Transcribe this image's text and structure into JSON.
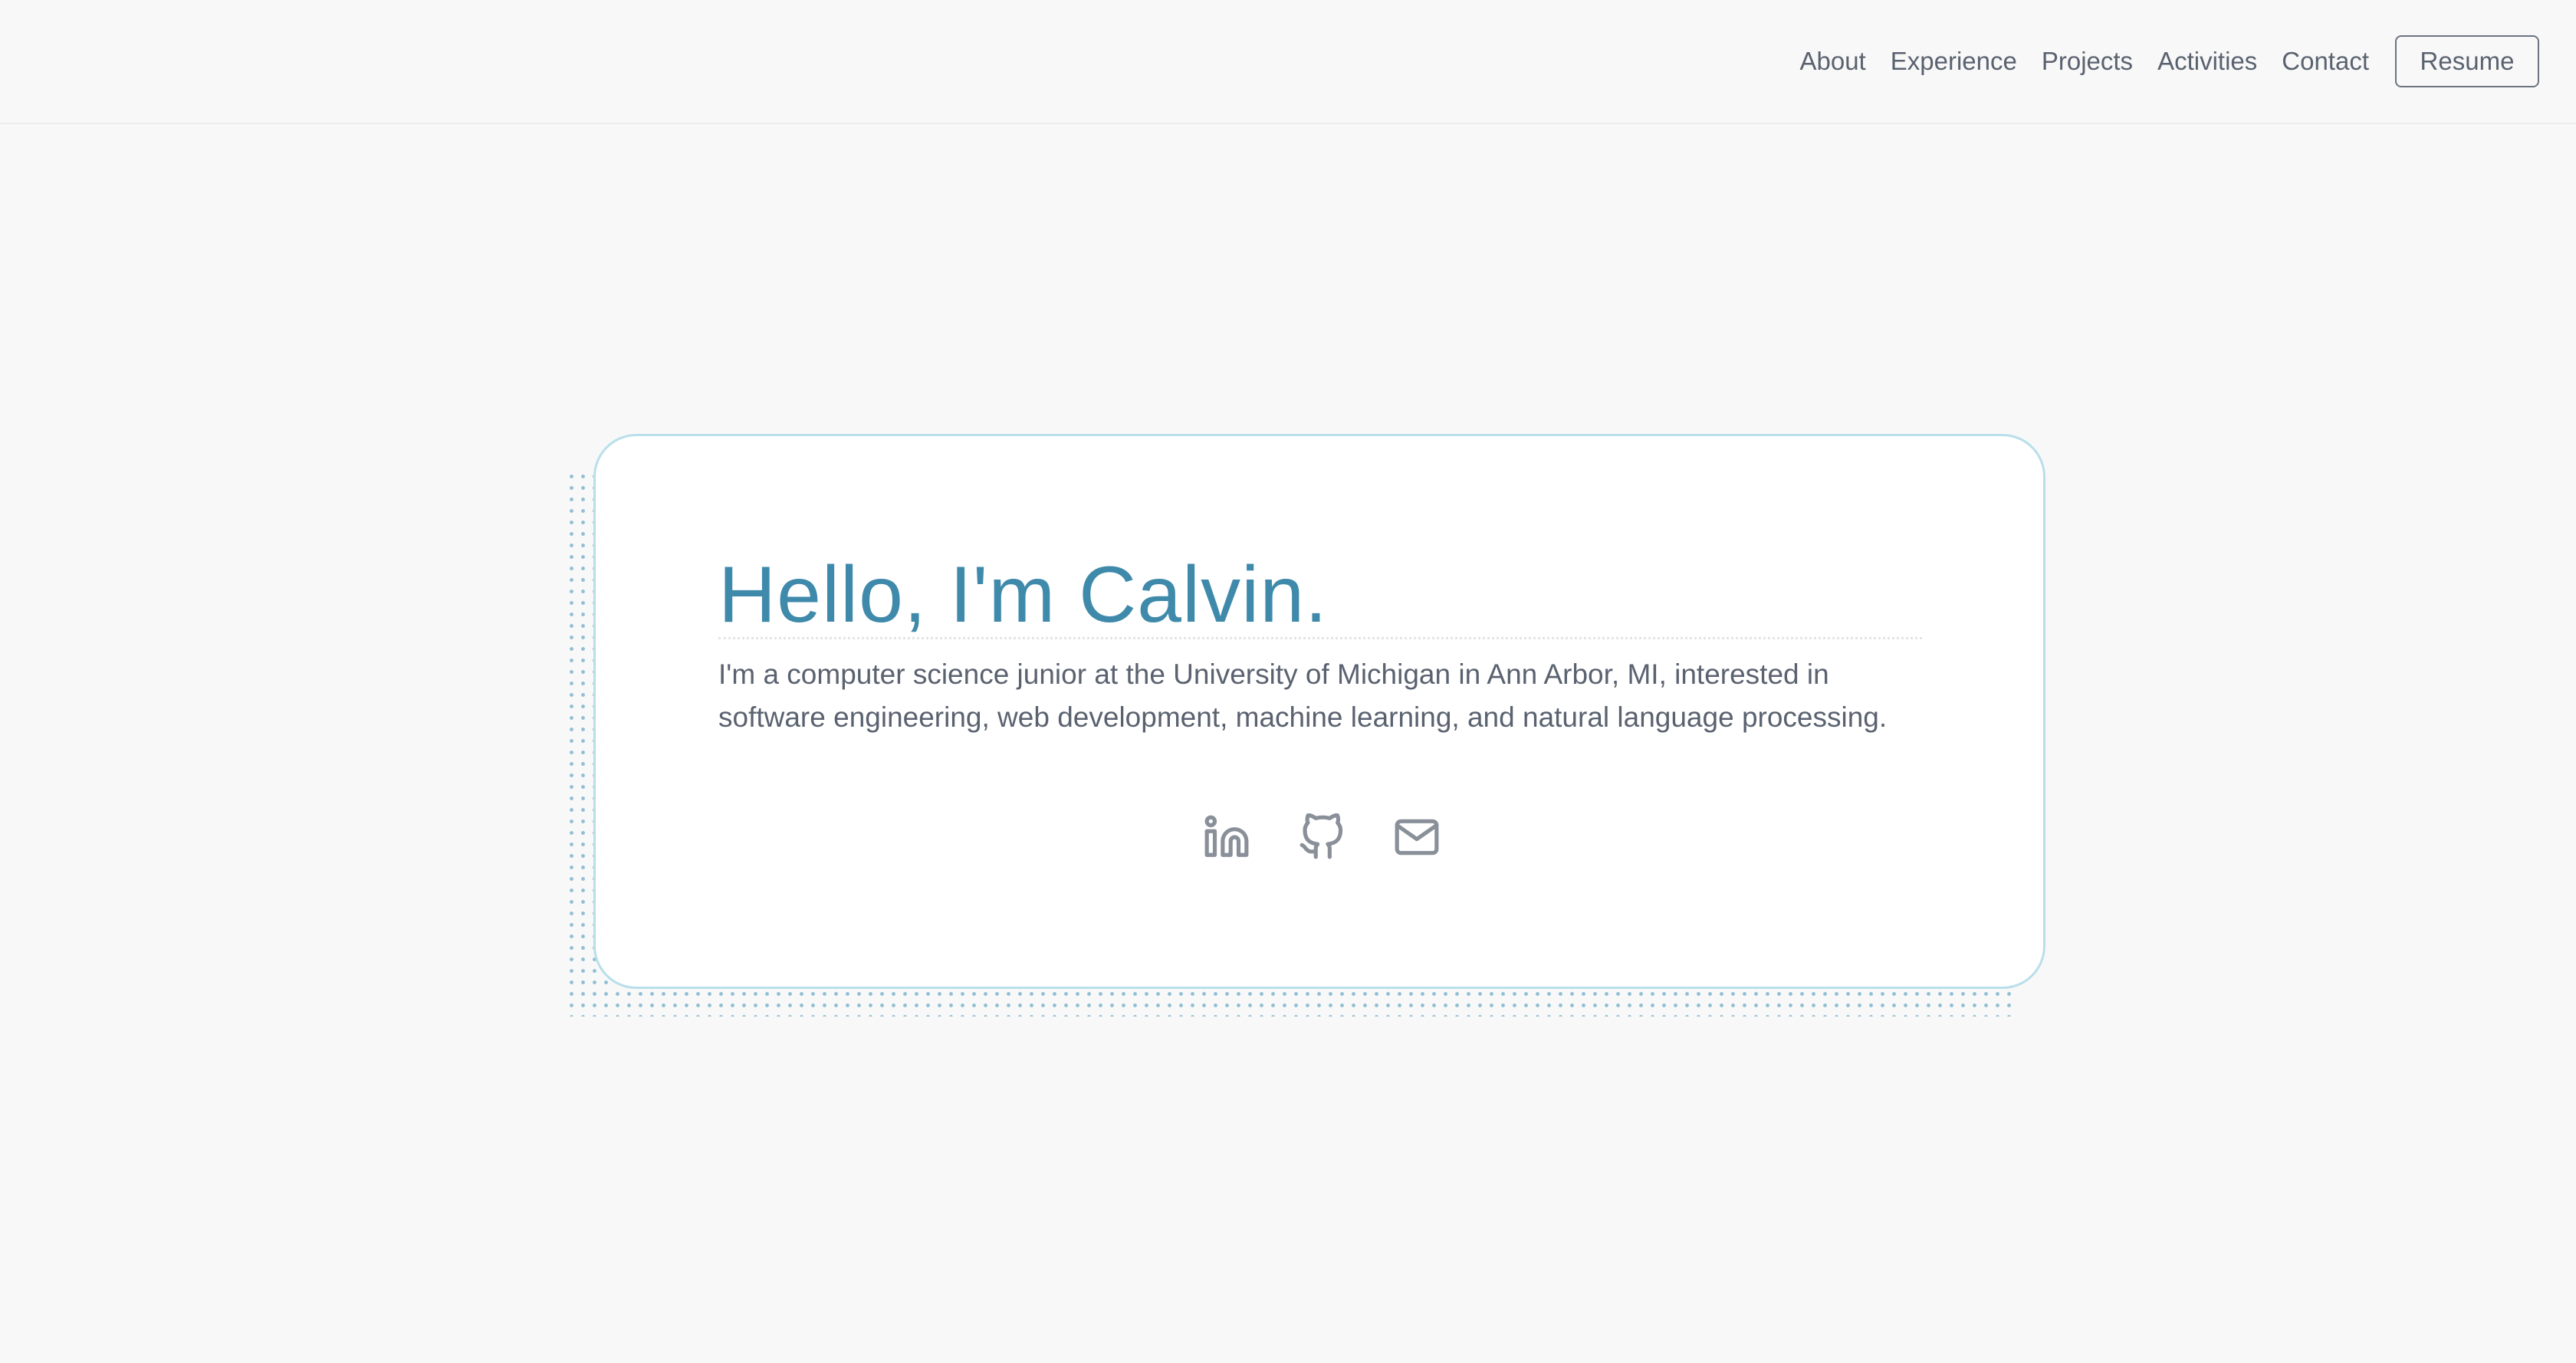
{
  "nav": {
    "links": [
      "About",
      "Experience",
      "Projects",
      "Activities",
      "Contact"
    ],
    "resume_label": "Resume"
  },
  "hero": {
    "headline": "Hello, I'm Calvin.",
    "bio": "I'm a computer science junior at the University of Michigan in Ann Arbor, MI, interested in software engineering, web development, machine learning, and natural language processing.",
    "socials": [
      {
        "name": "linkedin",
        "icon": "linkedin-icon"
      },
      {
        "name": "github",
        "icon": "github-icon"
      },
      {
        "name": "email",
        "icon": "mail-icon"
      }
    ]
  },
  "colors": {
    "accent": "#3f8aab",
    "card_border": "#b9dfea",
    "text": "#5a6270",
    "background": "#f8f8f8",
    "icon": "#8a9099"
  }
}
